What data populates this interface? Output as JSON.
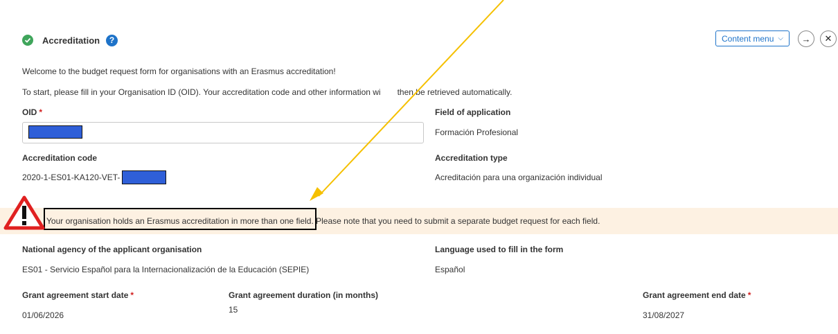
{
  "header": {
    "title": "Accreditation",
    "content_menu_label": "Content menu",
    "next_icon": "arrow-right-icon",
    "close_icon": "close-icon"
  },
  "intro": {
    "welcome": "Welcome to the budget request form for organisations with an Erasmus accreditation!",
    "instructions_before": "To start, please fill in your Organisation ID (OID). Your accreditation code and other information wi",
    "instructions_after": "then be retrieved automatically."
  },
  "fields": {
    "oid_label": "OID",
    "oid_required": "*",
    "field_of_application_label": "Field of application",
    "field_of_application_value": "Formación Profesional",
    "accreditation_code_label": "Accreditation code",
    "accreditation_code_value": "2020-1-ES01-KA120-VET-",
    "accreditation_type_label": "Accreditation type",
    "accreditation_type_value": "Acreditación para una organización individual"
  },
  "warning": {
    "highlighted": "Your organisation holds an Erasmus accreditation in more than one field.",
    "rest": " Please note that you need to submit a separate budget request for each field."
  },
  "agency": {
    "national_agency_label": "National agency of the applicant organisation",
    "national_agency_value": "ES01 - Servicio Español para la Internacionalización de la Educación (SEPIE)",
    "language_label": "Language used to fill in the form",
    "language_value": "Español"
  },
  "grant": {
    "start_label": "Grant agreement start date",
    "start_value": "01/06/2026",
    "duration_label": "Grant agreement duration (in months)",
    "duration_value": "15",
    "end_label": "Grant agreement end date",
    "end_value": "31/08/2027",
    "required": "*"
  },
  "colors": {
    "accent": "#1e73c9",
    "success": "#3fa55b",
    "warning_bg": "#fdf1e2",
    "arrow": "#f5c000",
    "alert_red": "#e02020",
    "redaction": "#2f5fd8"
  }
}
